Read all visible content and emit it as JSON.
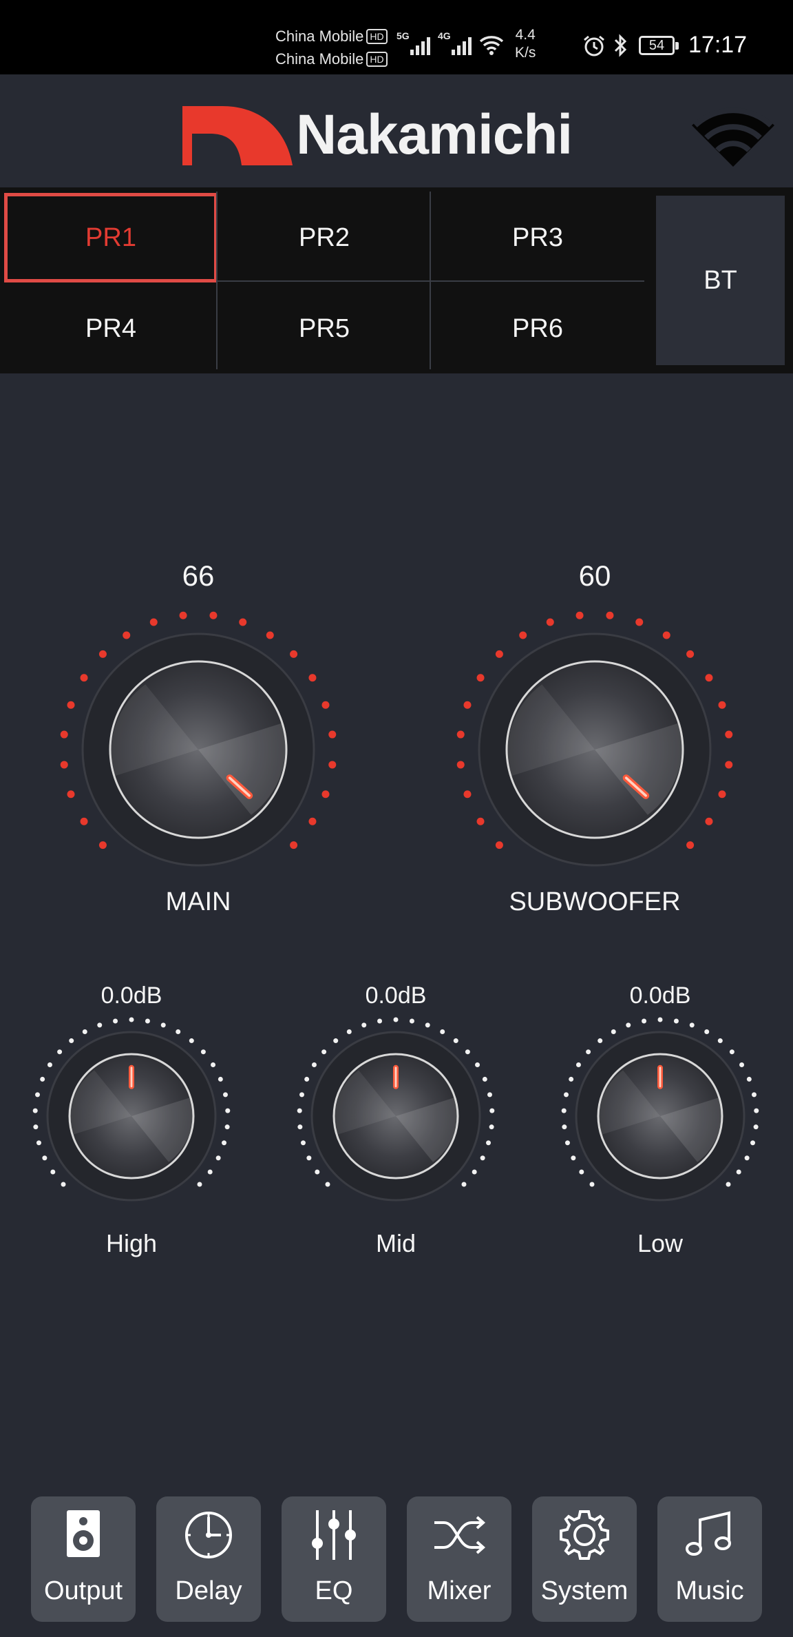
{
  "status_bar": {
    "carrier_1": "China Mobile",
    "carrier_2": "China Mobile",
    "hd_badge": "HD",
    "net_5g": "5G",
    "net_4g": "4G",
    "speed_value": "4.4",
    "speed_unit": "K/s",
    "battery": "54",
    "time": "17:17",
    "icons": [
      "signal-icon",
      "wifi-icon",
      "alarm-icon",
      "bluetooth-icon",
      "battery-icon"
    ]
  },
  "header": {
    "logo_text": "Nakamichi",
    "brand_color": "#e8392c",
    "wifi_icon": "wifi-icon"
  },
  "presets": {
    "items": [
      {
        "label": "PR1",
        "active": true
      },
      {
        "label": "PR2",
        "active": false
      },
      {
        "label": "PR3",
        "active": false
      },
      {
        "label": "PR4",
        "active": false
      },
      {
        "label": "PR5",
        "active": false
      },
      {
        "label": "PR6",
        "active": false
      }
    ],
    "bt_label": "BT",
    "active_color": "#e23b32"
  },
  "knobs": {
    "main": {
      "value": "66",
      "label": "MAIN"
    },
    "subwoofer": {
      "value": "60",
      "label": "SUBWOOFER"
    },
    "high": {
      "value": "0.0dB",
      "label": "High"
    },
    "mid": {
      "value": "0.0dB",
      "label": "Mid"
    },
    "low": {
      "value": "0.0dB",
      "label": "Low"
    }
  },
  "nav": {
    "items": [
      {
        "label": "Output",
        "icon": "speaker-icon"
      },
      {
        "label": "Delay",
        "icon": "clock-icon"
      },
      {
        "label": "EQ",
        "icon": "sliders-icon"
      },
      {
        "label": "Mixer",
        "icon": "shuffle-icon"
      },
      {
        "label": "System",
        "icon": "gear-icon"
      },
      {
        "label": "Music",
        "icon": "music-note-icon"
      }
    ]
  },
  "colors": {
    "background": "#272a33",
    "accent_red": "#e04b45",
    "nav_button": "#4a4e56"
  }
}
